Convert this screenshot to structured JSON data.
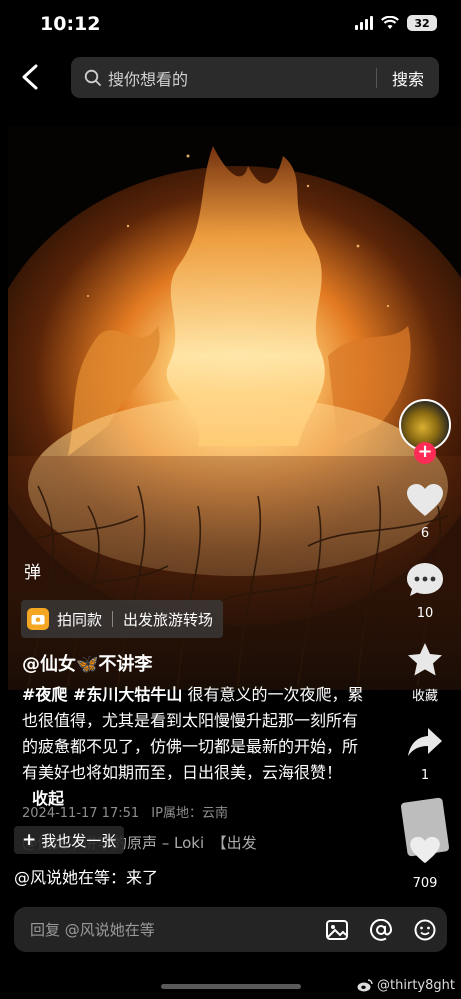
{
  "status_bar": {
    "time": "10:12",
    "battery": "32"
  },
  "search": {
    "placeholder": "搜你想看的",
    "submit_label": "搜索"
  },
  "actions": {
    "likes": "6",
    "comments": "10",
    "favorite_label": "收藏",
    "shares": "1",
    "record_count": "709"
  },
  "danmaku_label": "弹",
  "template_chip": {
    "label": "拍同款",
    "topic": "出发旅游转场"
  },
  "post": {
    "author": "@仙女🦋不讲李",
    "tags": "#夜爬 #东川大牯牛山",
    "text": "很有意义的一次夜爬，累也很值得，尤其是看到太阳慢慢升起那一刻所有的疲惫都不见了，仿佛一切都是最新的开始，所有美好也将如期而至，日出很美，云海很赞！",
    "collapse_label": "收起",
    "date": "2024-11-17 17:51",
    "ip_location": "IP属地：云南",
    "music": "@仙女不讲李的原声 – Loki　【出发"
  },
  "post_too_label": "我也发一张",
  "reply": {
    "target_line": "@风说她在等：来了",
    "placeholder": "回复 @风说她在等"
  },
  "watermark": "@thirty8ght",
  "colors": {
    "accent": "#fe2c55",
    "chip_icon": "#f5a623"
  },
  "icons": [
    "back-icon",
    "search-icon",
    "heart-icon",
    "comment-icon",
    "star-icon",
    "share-icon",
    "image-icon",
    "at-icon",
    "emoji-icon",
    "weibo-icon"
  ]
}
